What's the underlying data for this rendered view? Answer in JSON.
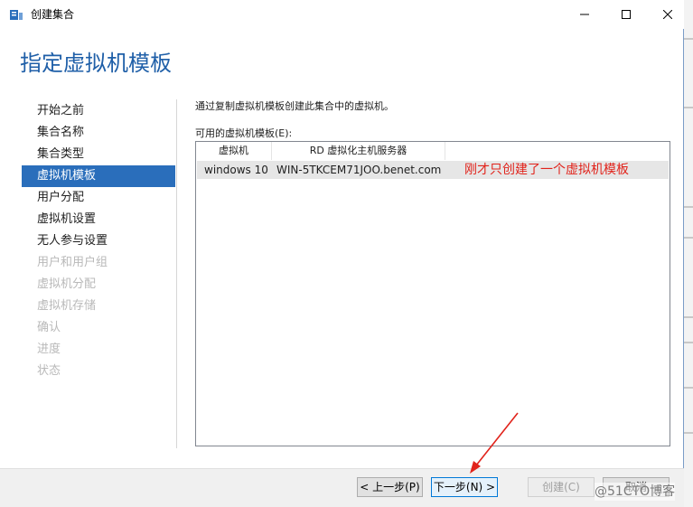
{
  "window": {
    "title": "创建集合"
  },
  "page": {
    "title": "指定虚拟机模板"
  },
  "nav": {
    "items": [
      {
        "label": "开始之前",
        "state": "normal"
      },
      {
        "label": "集合名称",
        "state": "normal"
      },
      {
        "label": "集合类型",
        "state": "normal"
      },
      {
        "label": "虚拟机模板",
        "state": "active"
      },
      {
        "label": "用户分配",
        "state": "normal"
      },
      {
        "label": "虚拟机设置",
        "state": "normal"
      },
      {
        "label": "无人参与设置",
        "state": "normal"
      },
      {
        "label": "用户和用户组",
        "state": "disabled"
      },
      {
        "label": "虚拟机分配",
        "state": "disabled"
      },
      {
        "label": "虚拟机存储",
        "state": "disabled"
      },
      {
        "label": "确认",
        "state": "disabled"
      },
      {
        "label": "进度",
        "state": "disabled"
      },
      {
        "label": "状态",
        "state": "disabled"
      }
    ]
  },
  "content": {
    "description": "通过复制虚拟机模板创建此集合中的虚拟机。",
    "list_label": "可用的虚拟机模板(E):",
    "columns": [
      "虚拟机",
      "RD 虚拟化主机服务器"
    ],
    "rows": [
      {
        "vm": "windows 10",
        "server": "WIN-5TKCEM71JOO.benet.com"
      }
    ],
    "annotation": "刚才只创建了一个虚拟机模板"
  },
  "footer": {
    "prev": "< 上一步(P)",
    "next": "下一步(N) >",
    "create": "创建(C)",
    "cancel": "取消"
  },
  "watermark": "@51CTO博客",
  "colors": {
    "accent": "#2a6ebb",
    "title": "#1f5fa8",
    "annotation": "#e1231b"
  }
}
